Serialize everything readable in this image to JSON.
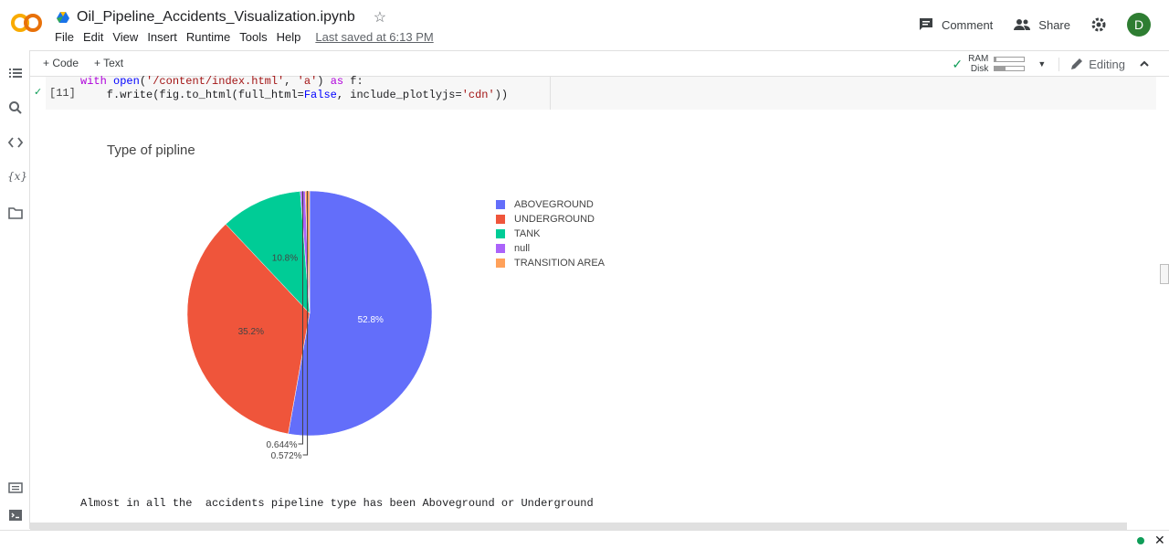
{
  "app": {
    "notebook_title": "Oil_Pipeline_Accidents_Visualization.ipynb",
    "menu": [
      "File",
      "Edit",
      "View",
      "Insert",
      "Runtime",
      "Tools",
      "Help"
    ],
    "last_saved": "Last saved at 6:13 PM",
    "comment_label": "Comment",
    "share_label": "Share",
    "avatar_initial": "D"
  },
  "toolbar": {
    "code_label": "+ Code",
    "text_label": "+ Text",
    "ram_label": "RAM",
    "disk_label": "Disk",
    "ram_usage": 0.05,
    "disk_usage": 0.35,
    "editing_label": "Editing"
  },
  "cell": {
    "exec_count": "[11]",
    "line1": "with open('/content/index.html', 'a') as f:",
    "line2": "    f.write(fig.to_html(full_html=False, include_plotlyjs='cdn'))"
  },
  "chart_data": {
    "type": "pie",
    "title": "Type of pipline",
    "categories": [
      "ABOVEGROUND",
      "UNDERGROUND",
      "TANK",
      "null",
      "TRANSITION AREA"
    ],
    "values": [
      52.8,
      35.2,
      10.8,
      0.644,
      0.572
    ],
    "labels": [
      "52.8%",
      "35.2%",
      "10.8%",
      "0.644%",
      "0.572%"
    ],
    "colors": [
      "#636efa",
      "#ef553b",
      "#00cc96",
      "#ab63fa",
      "#ffa15a"
    ],
    "legend_position": "right"
  },
  "output_text": "Almost in all the  accidents pipeline type has been Aboveground or Underground"
}
